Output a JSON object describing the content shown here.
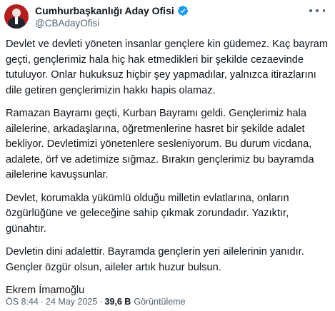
{
  "account": {
    "display_name": "Cumhurbaşkanlığı Aday Ofisi",
    "handle": "@CBAdayOfisi",
    "verified_icon": "verified-badge-icon",
    "accent": "#1d9bf0"
  },
  "tweet": {
    "paragraphs": [
      "Devlet ve devleti yöneten insanlar gençlere kin güdemez. Kaç bayram geçti, gençlerimiz hala hiç hak etmedikleri bir şekilde cezaevinde tutuluyor. Onlar hukuksuz hiçbir şey yapmadılar, yalnızca itirazlarını dile getiren gençlerimizin hakkı hapis olamaz.",
      "Ramazan Bayramı geçti, Kurban Bayramı geldi. Gençlerimiz hala ailelerine, arkadaşlarına, öğretmenlerine hasret bir şekilde adalet bekliyor. Devletimizi yönetenlere sesleniyorum. Bu durum vicdana, adalete, örf ve adetimize sığmaz. Bırakın gençlerimiz bu bayramda ailelerine kavuşsunlar.",
      "Devlet, korumakla yükümlü olduğu milletin evlatlarına, onların özgürlüğüne ve geleceğine sahip çıkmak zorundadır. Yazıktır, günahtır.",
      "Devletin dini adalettir. Bayramda gençlerin yeri ailelerinin yanıdır. Gençler özgür olsun, aileler artık huzur bulsun.",
      "Ekrem İmamoğlu"
    ]
  },
  "meta": {
    "time": "ÖS 8:44",
    "separator": "·",
    "date": "24 May 2025",
    "views_count": "39,6 B",
    "views_label": "Görüntüleme"
  }
}
